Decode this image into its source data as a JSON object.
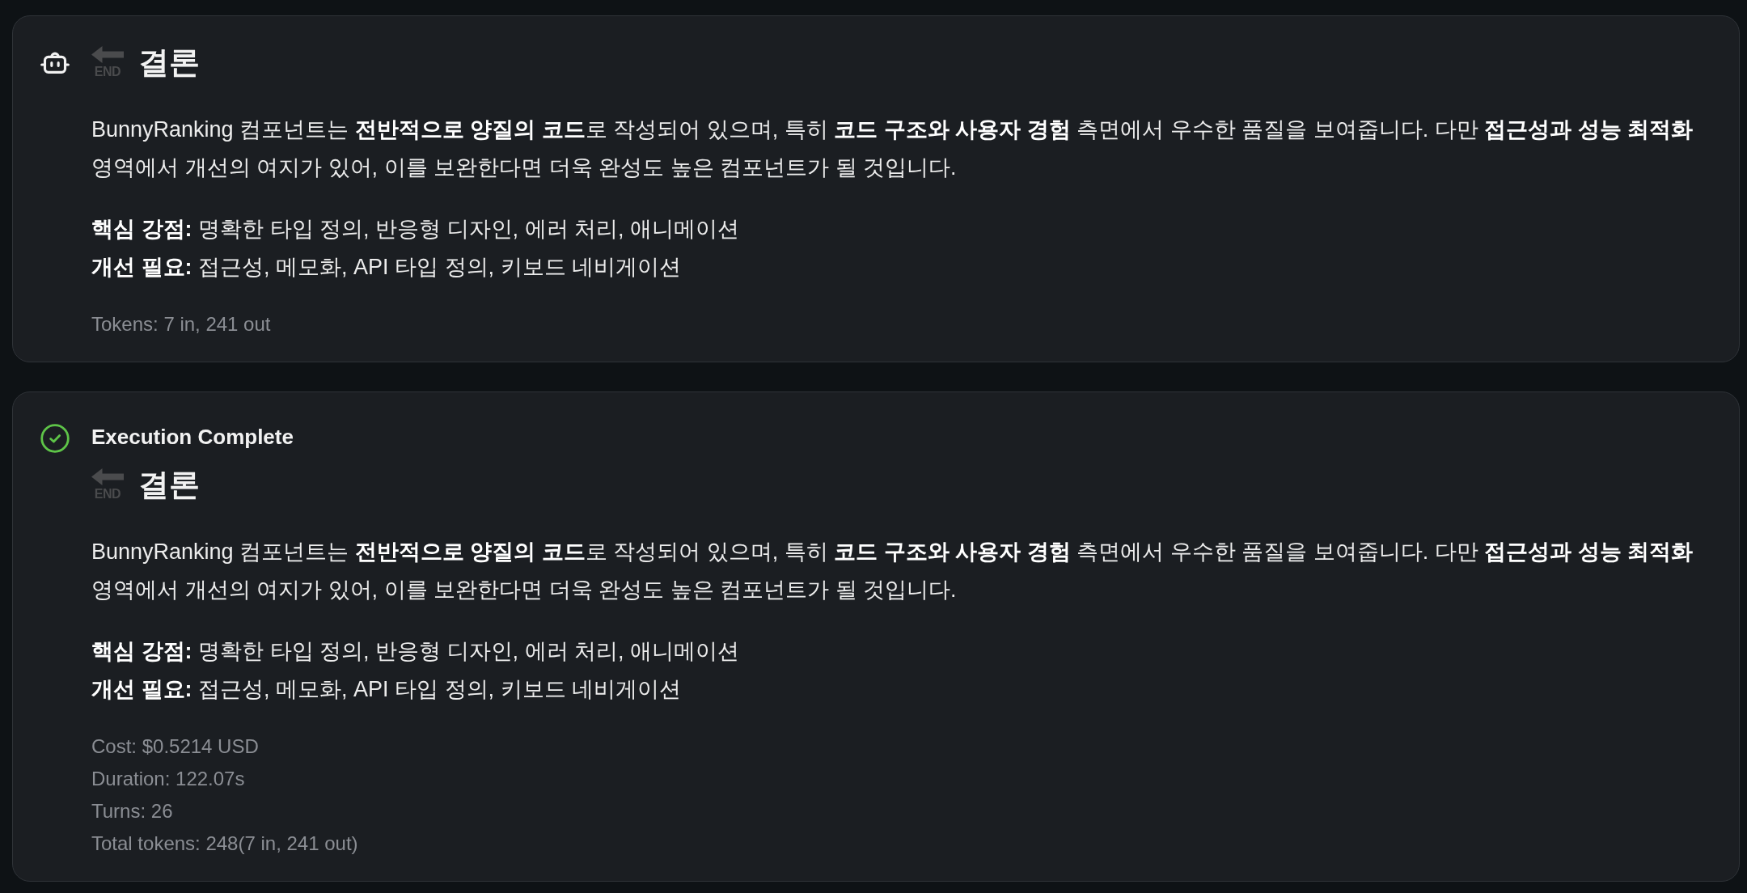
{
  "messages": [
    {
      "kind": "assistant",
      "heading": {
        "icon_label": "END",
        "title": "결론"
      },
      "paragraph": "BunnyRanking 컴포넌트는 **전반적으로 양질의 코드**로 작성되어 있으며, 특히 **코드 구조와 사용자 경험** 측면에서 우수한 품질을 보여줍니다. 다만 **접근성과 성능 최적화** 영역에서 개선의 여지가 있어, 이를 보완한다면 더욱 완성도 높은 컴포넌트가 될 것입니다.",
      "highlights": [
        "**핵심 강점:** 명확한 타입 정의, 반응형 디자인, 에러 처리, 애니메이션",
        "**개선 필요:** 접근성, 메모화, API 타입 정의, 키보드 네비게이션"
      ],
      "stats": [
        "Tokens: 7 in, 241 out"
      ]
    },
    {
      "kind": "result",
      "status": "Execution Complete",
      "heading": {
        "icon_label": "END",
        "title": "결론"
      },
      "paragraph": "BunnyRanking 컴포넌트는 **전반적으로 양질의 코드**로 작성되어 있으며, 특히 **코드 구조와 사용자 경험** 측면에서 우수한 품질을 보여줍니다. 다만 **접근성과 성능 최적화** 영역에서 개선의 여지가 있어, 이를 보완한다면 더욱 완성도 높은 컴포넌트가 될 것입니다.",
      "highlights": [
        "**핵심 강점:** 명확한 타입 정의, 반응형 디자인, 에러 처리, 애니메이션",
        "**개선 필요:** 접근성, 메모화, API 타입 정의, 키보드 네비게이션"
      ],
      "stats": [
        "Cost: $0.5214 USD",
        "Duration: 122.07s",
        "Turns: 26",
        "Total tokens: 248(7 in, 241 out)"
      ]
    }
  ]
}
